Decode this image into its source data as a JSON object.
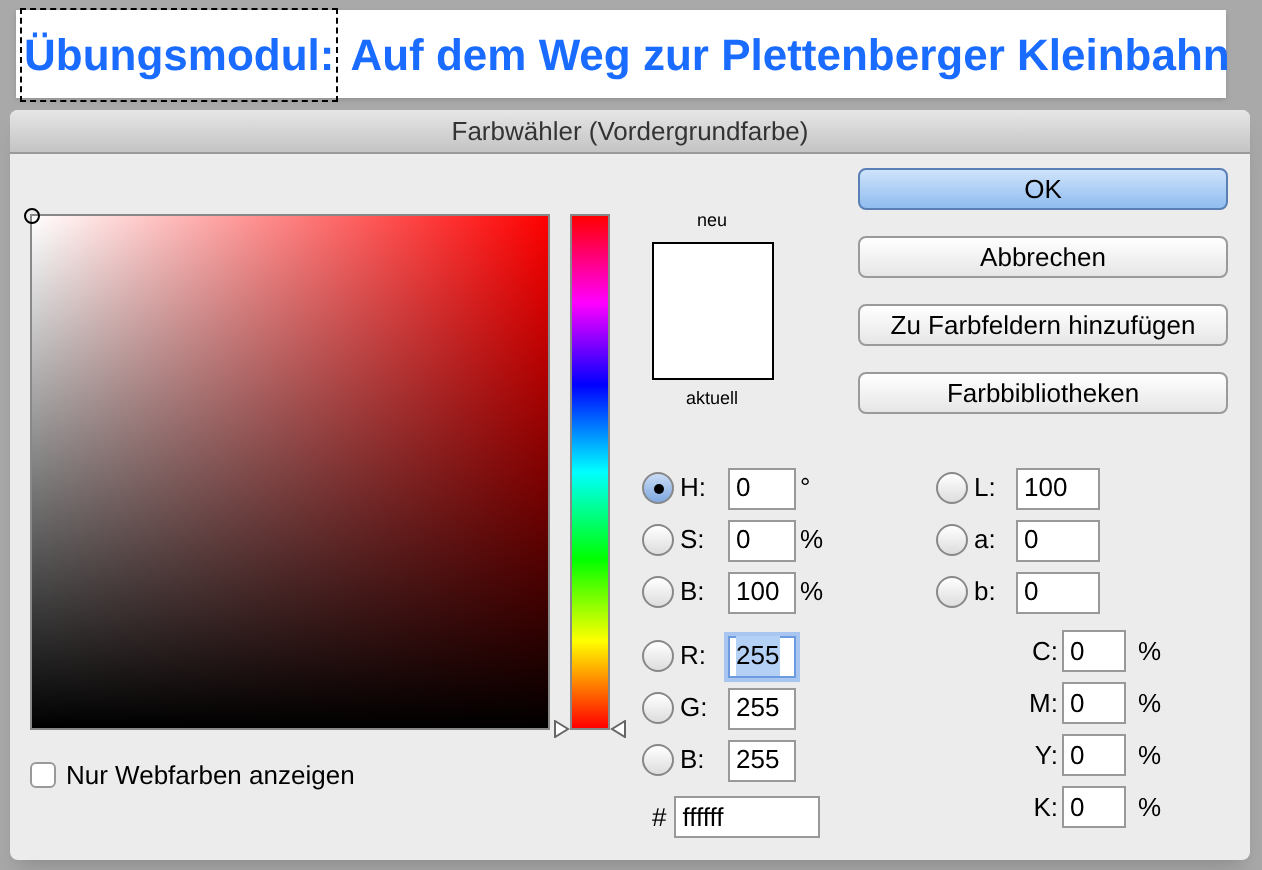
{
  "banner": {
    "label": "Übungsmodul:",
    "title": "Auf dem Weg zur Plettenberger Kleinbahn"
  },
  "window": {
    "title": "Farbwähler (Vordergrundfarbe)"
  },
  "hue_slider": {
    "level": 0
  },
  "webcolors_only": {
    "label": "Nur Webfarben anzeigen",
    "checked": false
  },
  "preview": {
    "new_label": "neu",
    "current_label": "aktuell"
  },
  "buttons": [
    {
      "label": "OK",
      "default": true
    },
    {
      "label": "Abbrechen",
      "default": false
    },
    {
      "label": "Zu Farbfeldern hinzufügen",
      "default": false
    },
    {
      "label": "Farbbibliotheken",
      "default": false
    }
  ],
  "hsb_rgb_fields": [
    {
      "label": "H:",
      "value": "0",
      "unit": "°",
      "selected": true,
      "focused": false
    },
    {
      "label": "S:",
      "value": "0",
      "unit": "%",
      "selected": false,
      "focused": false
    },
    {
      "label": "B:",
      "value": "100",
      "unit": "%",
      "selected": false,
      "focused": false
    },
    {
      "label": "R:",
      "value": "255",
      "selected": false,
      "focused": true
    },
    {
      "label": "G:",
      "value": "255",
      "selected": false,
      "focused": false
    },
    {
      "label": "B:",
      "value": "255",
      "selected": false,
      "focused": false
    }
  ],
  "hex_field": {
    "label": "#",
    "value": "ffffff"
  },
  "lab_fields": [
    {
      "label": "L:",
      "value": "100",
      "selected": false
    },
    {
      "label": "a:",
      "value": "0",
      "selected": false
    },
    {
      "label": "b:",
      "value": "0",
      "selected": false
    }
  ],
  "cmyk_fields": [
    {
      "label": "C:",
      "value": "0",
      "unit": "%"
    },
    {
      "label": "M:",
      "value": "0",
      "unit": "%"
    },
    {
      "label": "Y:",
      "value": "0",
      "unit": "%"
    },
    {
      "label": "K:",
      "value": "0",
      "unit": "%"
    }
  ]
}
